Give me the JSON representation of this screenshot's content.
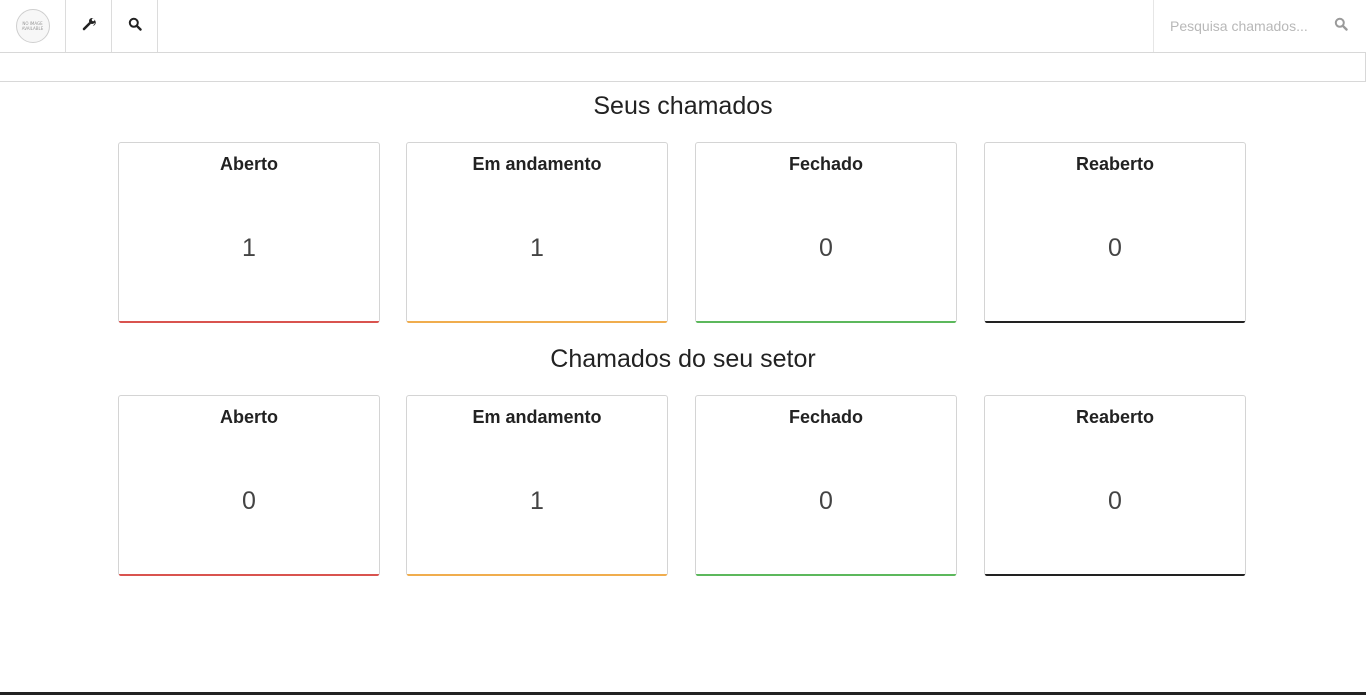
{
  "header": {
    "logo_text_line1": "NO IMAGE",
    "logo_text_line2": "AVAILABLE",
    "icons": [
      "wrench-icon",
      "search-icon"
    ],
    "search": {
      "placeholder": "Pesquisa chamados...",
      "value": ""
    }
  },
  "my_tickets": {
    "title": "Seus chamados",
    "cards": [
      {
        "label": "Aberto",
        "count": "1",
        "color": "#d9534f"
      },
      {
        "label": "Em andamento",
        "count": "1",
        "color": "#f0ad4e"
      },
      {
        "label": "Fechado",
        "count": "0",
        "color": "#5cb85c"
      },
      {
        "label": "Reaberto",
        "count": "0",
        "color": "#222222"
      }
    ]
  },
  "sector_tickets": {
    "title": "Chamados do seu setor",
    "cards": [
      {
        "label": "Aberto",
        "count": "0",
        "color": "#d9534f"
      },
      {
        "label": "Em andamento",
        "count": "1",
        "color": "#f0ad4e"
      },
      {
        "label": "Fechado",
        "count": "0",
        "color": "#5cb85c"
      },
      {
        "label": "Reaberto",
        "count": "0",
        "color": "#222222"
      }
    ]
  }
}
